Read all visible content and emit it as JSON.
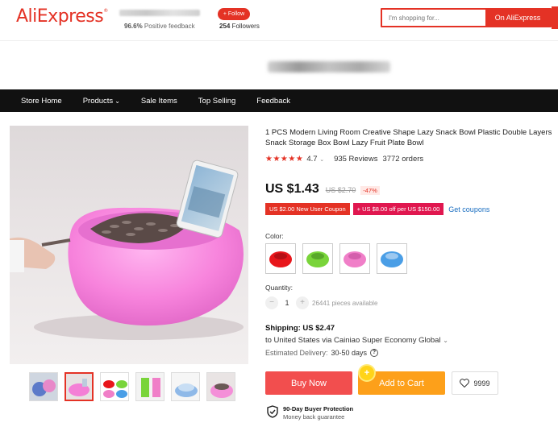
{
  "header": {
    "logo": "AliExpress",
    "feedback_value": "96.6%",
    "feedback_label": "Positive feedback",
    "follow_label": "+ Follow",
    "followers_count": "254",
    "followers_label": "Followers",
    "search_placeholder": "I'm shopping for...",
    "search_button": "On AliExpress"
  },
  "nav": {
    "items": [
      "Store Home",
      "Products",
      "Sale Items",
      "Top Selling",
      "Feedback"
    ]
  },
  "product": {
    "title": "1 PCS Modern Living Room Creative Shape Lazy Snack Bowl Plastic Double Layers Snack Storage Box Bowl Lazy Fruit Plate Bowl",
    "stars": "★★★★★",
    "rating": "4.7",
    "reviews": "935 Reviews",
    "orders": "3772 orders",
    "price": "US $1.43",
    "old_price": "US $2.70",
    "discount": "-47%",
    "coupons": [
      "US $2.00 New User Coupon",
      "+ US $8.00 off per US $150.00"
    ],
    "get_coupons": "Get coupons",
    "color_label": "Color:",
    "colors": [
      {
        "name": "red",
        "hex": "#e8161b"
      },
      {
        "name": "green",
        "hex": "#79d43a"
      },
      {
        "name": "pink",
        "hex": "#f07fc8"
      },
      {
        "name": "blue",
        "hex": "#4a9ee6"
      }
    ],
    "quantity_label": "Quantity:",
    "quantity": "1",
    "pieces_available": "26441 pieces available",
    "shipping": "Shipping: US $2.47",
    "ship_to": "to United States via Cainiao Super Economy Global",
    "delivery_label": "Estimated Delivery:",
    "delivery_days": "30-50 days",
    "buy_now": "Buy Now",
    "add_to_cart": "Add to Cart",
    "wishlist_count": "9999",
    "protection_title": "90-Day Buyer Protection",
    "protection_sub": "Money back guarantee"
  },
  "colors": {
    "brand": "#e43225",
    "buy_now": "#f24e4e",
    "add_cart": "#fda01a",
    "nav_bg": "#111111",
    "link": "#1a6ec1"
  }
}
